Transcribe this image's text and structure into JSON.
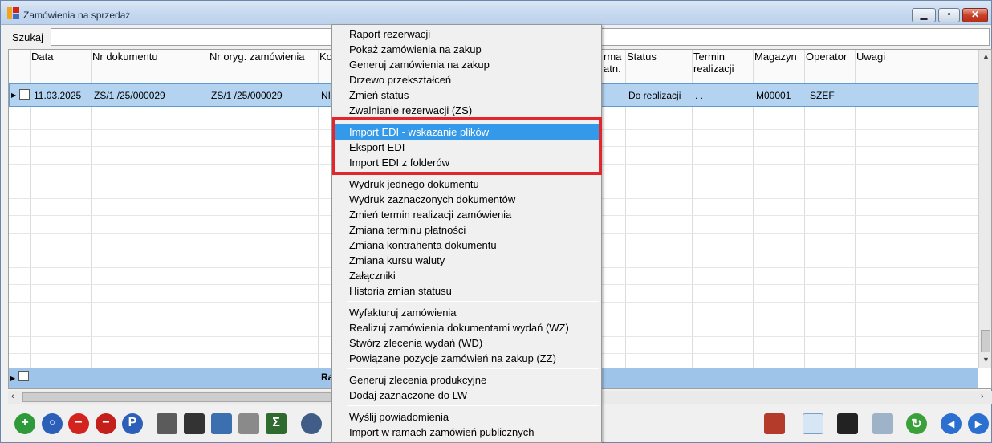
{
  "window": {
    "title": "Zamówienia na sprzedaż"
  },
  "search": {
    "label": "Szukaj",
    "value": ""
  },
  "columns": {
    "data": "Data",
    "nr_dok": "Nr dokumentu",
    "nr_oryg": "Nr oryg. zamówienia",
    "kontrahent": "Ko",
    "forma_1": "rma",
    "forma_2": "atn.",
    "status": "Status",
    "termin_1": "Termin",
    "termin_2": "realizacji",
    "magazyn": "Magazyn",
    "operator": "Operator",
    "uwagi": "Uwagi"
  },
  "row": {
    "data": "11.03.2025",
    "nr_dok": "ZS/1  /25/000029",
    "nr_oryg": "ZS/1  /25/000029",
    "kontrahent": "NI",
    "status": "Do realizacji",
    "termin": ". .",
    "magazyn": "M00001",
    "operator": "SZEF"
  },
  "summary": {
    "label": "Ra"
  },
  "context_menu": {
    "items": [
      {
        "label": "Raport rezerwacji"
      },
      {
        "label": "Pokaż zamówienia na zakup"
      },
      {
        "label": "Generuj zamówienia na zakup"
      },
      {
        "label": "Drzewo przekształceń"
      },
      {
        "label": "Zmień status"
      },
      {
        "label": "Zwalnianie rezerwacji (ZS)"
      },
      {
        "label": "Import EDI - wskazanie plików",
        "highlighted": true
      },
      {
        "label": "Eksport EDI"
      },
      {
        "label": "Import EDI z folderów"
      },
      {
        "label": "Wydruk jednego dokumentu"
      },
      {
        "label": "Wydruk zaznaczonych dokumentów"
      },
      {
        "label": "Zmień termin realizacji zamówienia"
      },
      {
        "label": "Zmiana terminu płatności"
      },
      {
        "label": "Zmiana kontrahenta dokumentu"
      },
      {
        "label": "Zmiana kursu waluty"
      },
      {
        "label": "Załączniki"
      },
      {
        "label": "Historia zmian statusu"
      },
      {
        "label": "Wyfakturuj zamówienia"
      },
      {
        "label": "Realizuj zamówienia dokumentami wydań (WZ)"
      },
      {
        "label": "Stwórz zlecenia wydań (WD)"
      },
      {
        "label": "Powiązane pozycje zamówień na zakup (ZZ)"
      },
      {
        "label": "Generuj zlecenia produkcyjne"
      },
      {
        "label": "Dodaj zaznaczone do LW"
      },
      {
        "label": "Wyślij powiadomienia"
      },
      {
        "label": "Import w ramach zamówień publicznych"
      }
    ]
  },
  "toolbar_icons": {
    "add": "plus-icon",
    "search": "magnifier-icon",
    "delete": "minus-icon",
    "delete_menu": "minus-dropdown-icon",
    "p": "P",
    "print": "printer-icon",
    "binoculars": "binoculars-icon",
    "calendar": "calendar-icon",
    "sum": "Σ",
    "gears": "gears-icon",
    "chart": "chart-icon",
    "doc": "document-icon",
    "save": "floppy-icon",
    "window": "windows-icon",
    "refresh": "refresh-icon",
    "prev": "prev-icon",
    "next": "next-icon"
  },
  "colors": {
    "selection": "#b3d3f0",
    "menu_highlight": "#3399e8",
    "callout": "#e3262b",
    "summary_row": "#9fc4ea"
  }
}
